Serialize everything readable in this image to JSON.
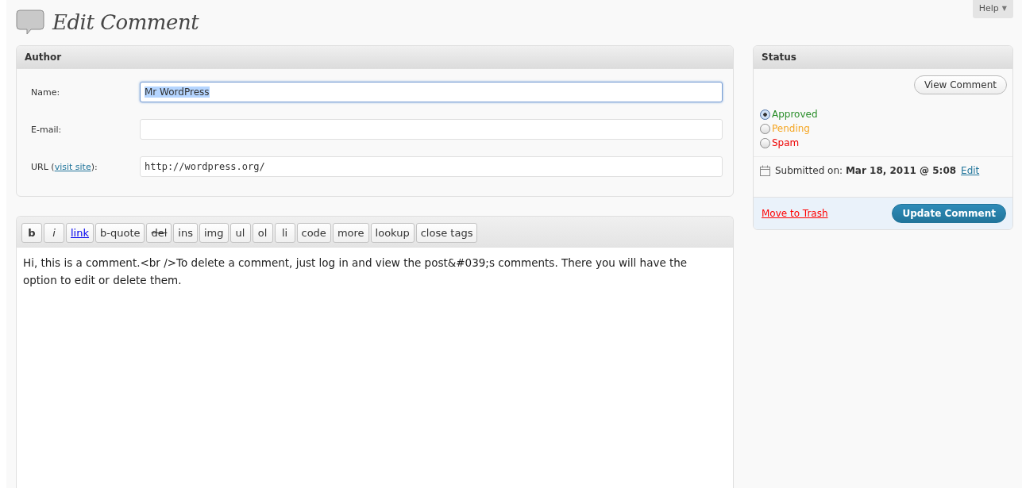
{
  "help": {
    "label": "Help",
    "caret": "▼"
  },
  "title": "Edit Comment",
  "author": {
    "heading": "Author",
    "fields": [
      {
        "label": "Name:",
        "value": "Mr WordPress",
        "focused": true,
        "mono": false
      },
      {
        "label": "E-mail:",
        "focused": false
      },
      {
        "label": "URL (",
        "link": "visit site",
        "label_end": "):",
        "value": "http://wordpress.org/",
        "focused": false,
        "mono": true
      }
    ]
  },
  "quicktags": [
    {
      "label": "b",
      "kind": "bold"
    },
    {
      "label": "i",
      "kind": "italic"
    },
    {
      "label": "link",
      "kind": "link"
    },
    {
      "label": "b-quote",
      "kind": "plain"
    },
    {
      "label": "del",
      "kind": "strike"
    },
    {
      "label": "ins",
      "kind": "plain"
    },
    {
      "label": "img",
      "kind": "plain"
    },
    {
      "label": "ul",
      "kind": "plain"
    },
    {
      "label": "ol",
      "kind": "plain"
    },
    {
      "label": "li",
      "kind": "plain"
    },
    {
      "label": "code",
      "kind": "plain"
    },
    {
      "label": "more",
      "kind": "plain"
    },
    {
      "label": "lookup",
      "kind": "plain"
    },
    {
      "label": "close tags",
      "kind": "plain"
    }
  ],
  "content": "Hi, this is a comment.<br />To delete a comment, just log in and view the post&#039;s comments. There you will have the option to edit or delete them.",
  "status": {
    "heading": "Status",
    "view_button": "View Comment",
    "options": [
      {
        "label": "Approved",
        "selected": true,
        "color": "#2a8e2a"
      },
      {
        "label": "Pending",
        "selected": false,
        "color": "#f5a623"
      },
      {
        "label": "Spam",
        "selected": false,
        "color": "#ee0000"
      }
    ],
    "submitted": "Submitted on: **Mar 18, 2011 @ 5:08**",
    "edit_link": "Edit",
    "trash": "Move to Trash",
    "update_button": "Update Comment"
  }
}
